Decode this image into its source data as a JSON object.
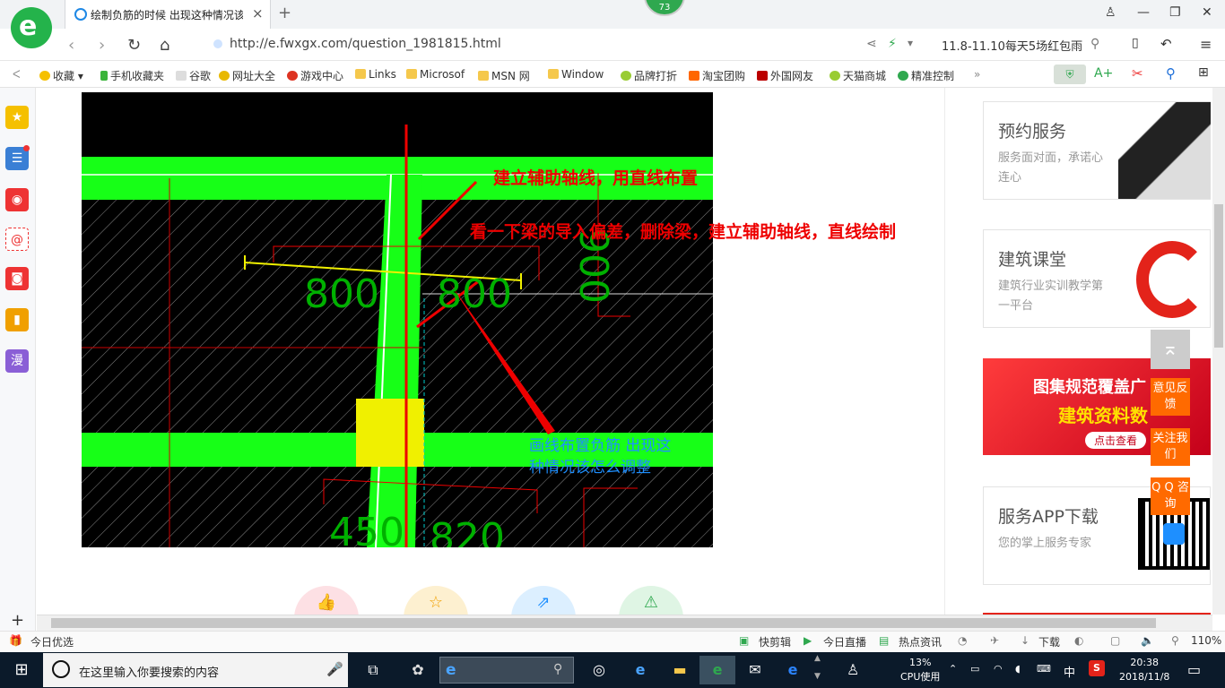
{
  "browser": {
    "badge_count": "73",
    "tab_title": "绘制负筋的时候 出现这种情况该",
    "new_tab_label": "+",
    "url": "http://e.fwxgx.com/question_1981815.html",
    "promo_text": "11.8-11.10每天5场红包雨",
    "bookmarks": [
      "收藏",
      "手机收藏夹",
      "谷歌",
      "网址大全",
      "游戏中心",
      "Links",
      "Microsof",
      "MSN 网",
      "Window",
      "品牌打折",
      "淘宝团购",
      "外国网友",
      "天猫商城",
      "精准控制"
    ],
    "more_bookmarks": "»"
  },
  "cad_image": {
    "annotation_1": "建立辅助轴线，用直线布置",
    "annotation_2": "看一下梁的导入偏差，删除梁，建立辅助轴线，直线绘制",
    "annotation_3_line1": "画线布置负筋 出现这",
    "annotation_3_line2": "种情况该怎么调整",
    "dim_800_left": "800",
    "dim_800_right": "800",
    "dim_900": "900",
    "dim_450": "450",
    "dim_820": "820"
  },
  "cards": [
    {
      "title": "预约服务",
      "desc": "服务面对面，承诺心连心"
    },
    {
      "title": "建筑课堂",
      "desc": "建筑行业实训教学第一平台"
    },
    {
      "banner_title": "图集规范覆盖广",
      "banner_sub": "建筑资料数",
      "banner_button": "点击查看"
    },
    {
      "title": "服务APP下载",
      "desc": "您的掌上服务专家"
    }
  ],
  "floats": {
    "feedback": "意见反馈",
    "follow": "关注我们",
    "qq": "Q Q 咨询"
  },
  "status": {
    "left": "今日优选",
    "items": [
      "快剪辑",
      "今日直播",
      "热点资讯",
      "下载"
    ],
    "zoom": "110%"
  },
  "taskbar": {
    "search_placeholder": "在这里输入你要搜索的内容",
    "cpu_percent": "13%",
    "cpu_label": "CPU使用",
    "ime": "中",
    "time": "20:38",
    "date": "2018/11/8"
  },
  "colors": {
    "accent_green": "#24b34b",
    "cad_green": "#17ff17",
    "annotation_red": "#e00000",
    "annotation_blue": "#1e8fff",
    "float_orange": "#ff6a00"
  }
}
